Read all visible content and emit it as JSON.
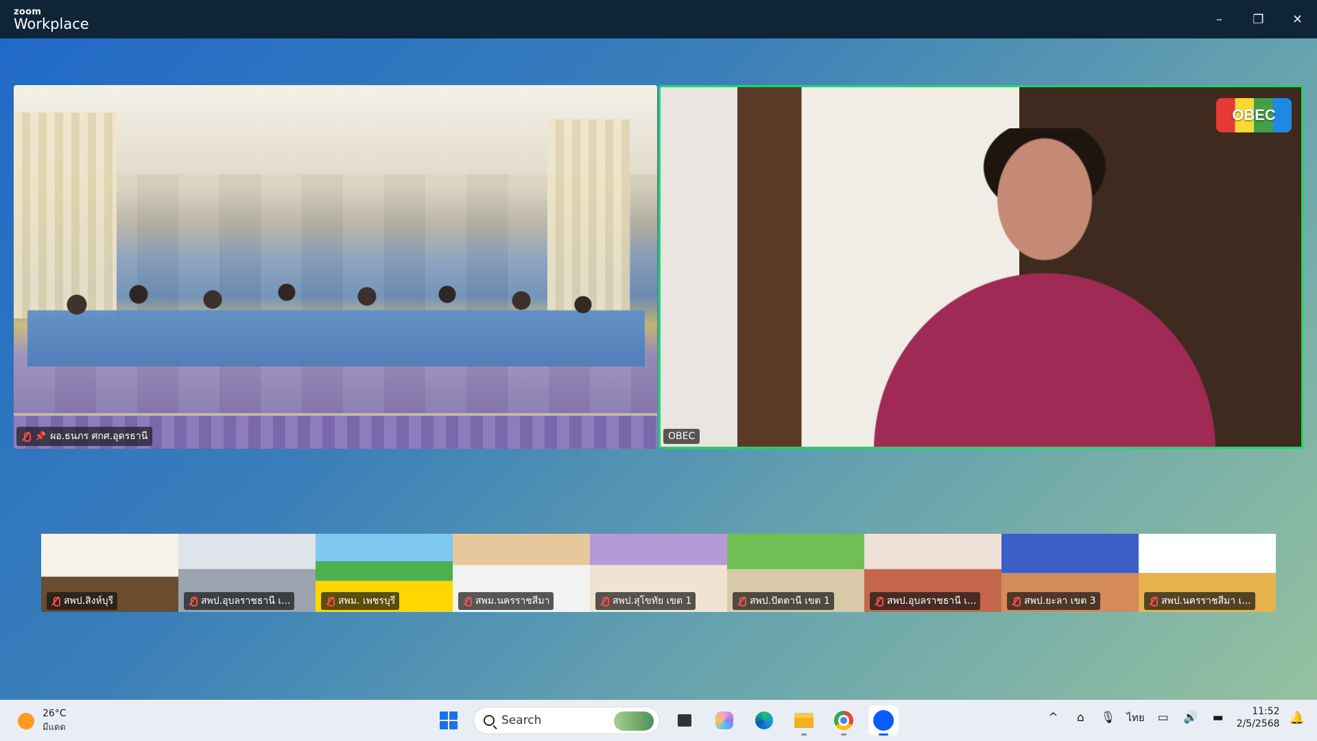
{
  "window": {
    "brand_small": "zoom",
    "brand_big": "Workplace",
    "minimize_icon": "–",
    "restore_icon": "❐",
    "close_icon": "✕"
  },
  "main_tiles": [
    {
      "name": "ผอ.ธนภร ศกศ.อุดรธานี",
      "muted": true,
      "pinned": true
    },
    {
      "name": "OBEC",
      "active_speaker": true,
      "logo_text": "OBEC"
    }
  ],
  "thumbnails": [
    {
      "name": "สพป.สิงห์บุรี"
    },
    {
      "name": "สพป.อุบลราชธานี เ..."
    },
    {
      "name": "สพม. เพชรบุรี"
    },
    {
      "name": "สพม.นครราชสีมา"
    },
    {
      "name": "สพป.สุโขทัย เขต 1"
    },
    {
      "name": "สพป.ปัตตานี เขต 1"
    },
    {
      "name": "สพป.อุบลราชธานี เ..."
    },
    {
      "name": "สพป.ยะลา เขต 3"
    },
    {
      "name": "สพป.นครราชสีมา เ..."
    }
  ],
  "taskbar": {
    "weather_temp": "26°C",
    "weather_cond": "มีแดด",
    "search_placeholder": "Search",
    "language": "ไทย",
    "time": "11:52",
    "date": "2/5/2568",
    "up_arrow_icon": "^",
    "network_icon": "⌂",
    "mic_icon": "🎙",
    "monitor_icon": "▭",
    "volume_icon": "🔊",
    "battery_icon": "▬",
    "bell_icon": "🔔"
  },
  "colors": {
    "active_speaker_border": "#1ed760",
    "titlebar": "#0f2437",
    "mute_red": "#ff4d4d"
  }
}
